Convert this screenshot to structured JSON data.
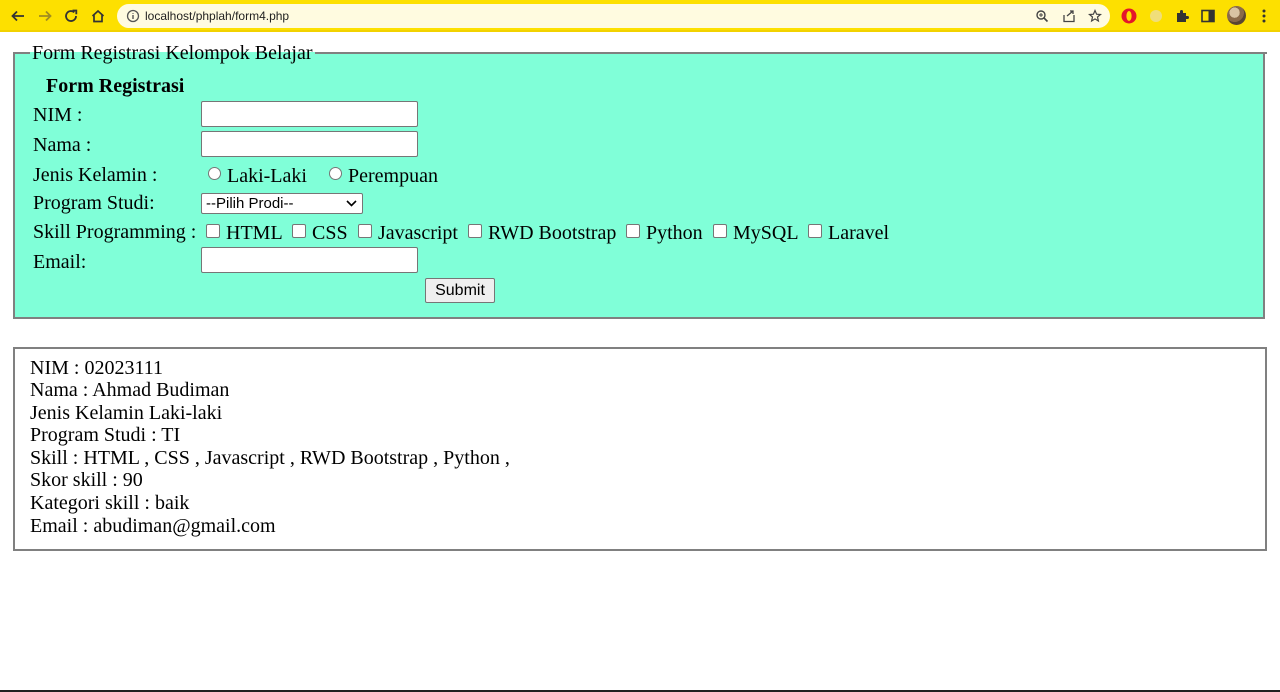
{
  "browser": {
    "url": "localhost/phplah/form4.php"
  },
  "form": {
    "legend": "Form Registrasi Kelompok Belajar",
    "title": "Form Registrasi",
    "nim_label": "NIM :",
    "nama_label": "Nama :",
    "gender_label": "Jenis Kelamin :",
    "gender_options": [
      "Laki-Laki",
      "Perempuan"
    ],
    "prodi_label": "Program Studi:",
    "prodi_selected": "--Pilih Prodi--",
    "skill_label": "Skill Programming :",
    "skills": [
      "HTML",
      "CSS",
      "Javascript",
      "RWD Bootstrap",
      "Python",
      "MySQL",
      "Laravel"
    ],
    "email_label": "Email:",
    "submit_label": "Submit"
  },
  "result": {
    "lines": [
      "NIM : 02023111",
      "Nama : Ahmad Budiman",
      "Jenis Kelamin Laki-laki",
      "Program Studi : TI",
      "Skill : HTML , CSS , Javascript , RWD Bootstrap , Python ,",
      "Skor skill : 90",
      "Kategori skill : baik",
      "Email : abudiman@gmail.com"
    ]
  },
  "colors": {
    "chrome": "#fde000",
    "form_background": "#80ffd8",
    "border": "#808080"
  }
}
